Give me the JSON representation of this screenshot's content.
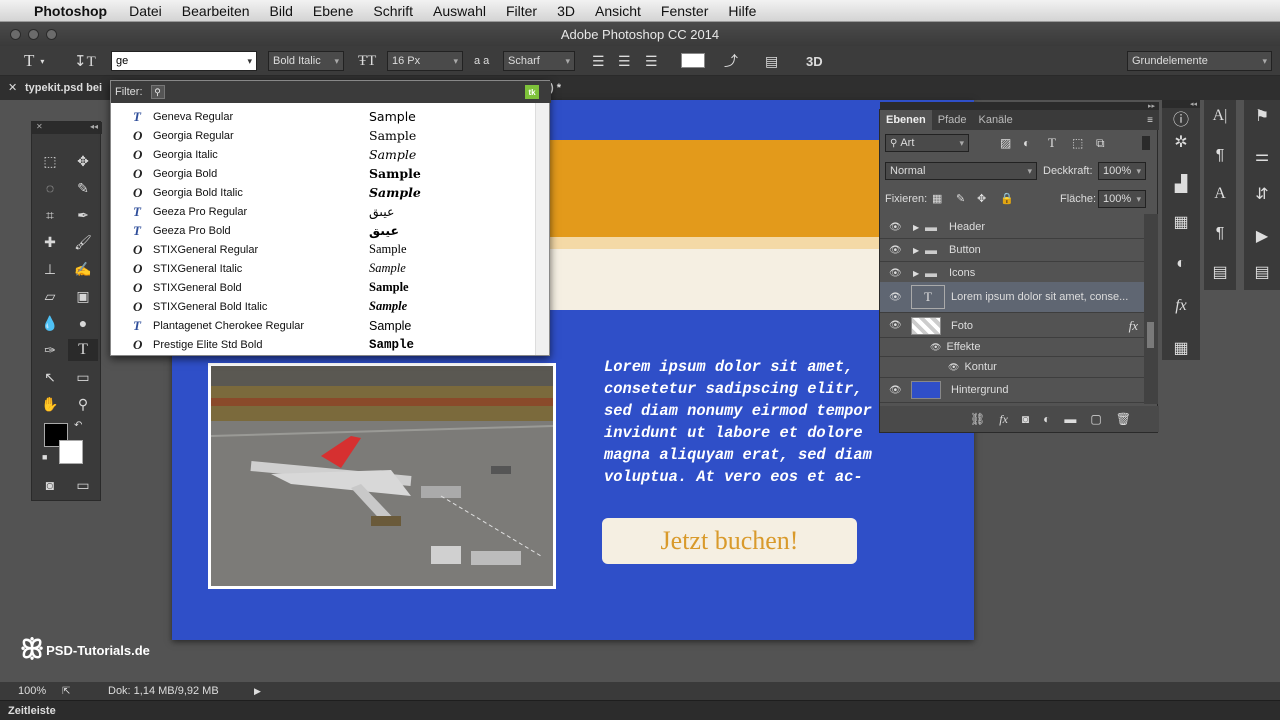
{
  "menubar": {
    "app": "Photoshop",
    "items": [
      "Datei",
      "Bearbeiten",
      "Bild",
      "Ebene",
      "Schrift",
      "Auswahl",
      "Filter",
      "3D",
      "Ansicht",
      "Fenster",
      "Hilfe"
    ]
  },
  "window_title": "Adobe Photoshop CC 2014",
  "options": {
    "font_search": "ge",
    "font_style": "Bold Italic",
    "font_size": "16 Px",
    "aa_label": "a a",
    "antialias": "Scharf",
    "threed": "3D",
    "workspace": "Grundelemente"
  },
  "doc_tab": {
    "name": "typekit.psd bei",
    "suffix": ") *"
  },
  "font_dropdown": {
    "filter_label": "Filter:",
    "fonts": [
      {
        "name": "Geneva Regular",
        "sample": "Sample",
        "icon": "T"
      },
      {
        "name": "Georgia Regular",
        "sample": "Sample",
        "icon": "O"
      },
      {
        "name": "Georgia Italic",
        "sample": "Sample",
        "icon": "O"
      },
      {
        "name": "Georgia Bold",
        "sample": "Sample",
        "icon": "O"
      },
      {
        "name": "Georgia Bold Italic",
        "sample": "Sample",
        "icon": "O"
      },
      {
        "name": "Geeza Pro Regular",
        "sample": "عيىق",
        "icon": "T"
      },
      {
        "name": "Geeza Pro Bold",
        "sample": "عيىق",
        "icon": "T"
      },
      {
        "name": "STIXGeneral Regular",
        "sample": "Sample",
        "icon": "O"
      },
      {
        "name": "STIXGeneral Italic",
        "sample": "Sample",
        "icon": "O"
      },
      {
        "name": "STIXGeneral Bold",
        "sample": "Sample",
        "icon": "O"
      },
      {
        "name": "STIXGeneral Bold Italic",
        "sample": "Sample",
        "icon": "O"
      },
      {
        "name": "Plantagenet Cherokee Regular",
        "sample": "Sample",
        "icon": "T"
      },
      {
        "name": "Prestige Elite Std Bold",
        "sample": "Sample",
        "icon": "O"
      }
    ]
  },
  "canvas": {
    "body_text": "Lorem ipsum dolor sit amet,\nconsetetur sadipscing elitr,\nsed diam nonumy eirmod tempor\ninvidunt ut labore et dolore\nmagna aliquyam erat, sed diam\nvoluptua. At vero eos et ac-",
    "cta": "Jetzt buchen!",
    "colors": {
      "blue": "#2f4fc8",
      "orange": "#e39a1b",
      "cream": "#f5efe2",
      "button_text": "#d99a2b"
    }
  },
  "layers_panel": {
    "tabs": [
      "Ebenen",
      "Pfade",
      "Kanäle"
    ],
    "kind_filter": "Art",
    "blend_mode": "Normal",
    "opacity_label": "Deckkraft:",
    "opacity": "100%",
    "lock_label": "Fixieren:",
    "fill_label": "Fläche:",
    "fill": "100%",
    "layers": [
      {
        "name": "Header",
        "type": "group"
      },
      {
        "name": "Button",
        "type": "group"
      },
      {
        "name": "Icons",
        "type": "group"
      },
      {
        "name": "Lorem ipsum dolor sit amet, conse...",
        "type": "text"
      },
      {
        "name": "Foto",
        "type": "image",
        "fx": "fx"
      },
      {
        "name": "Effekte",
        "type": "effects"
      },
      {
        "name": "Kontur",
        "type": "effect"
      },
      {
        "name": "Hintergrund",
        "type": "fill"
      }
    ]
  },
  "watermark": "PSD-Tutorials.de",
  "status": {
    "zoom": "100%",
    "doc": "Dok: 1,14 MB/9,92 MB"
  },
  "timeline": "Zeitleiste"
}
